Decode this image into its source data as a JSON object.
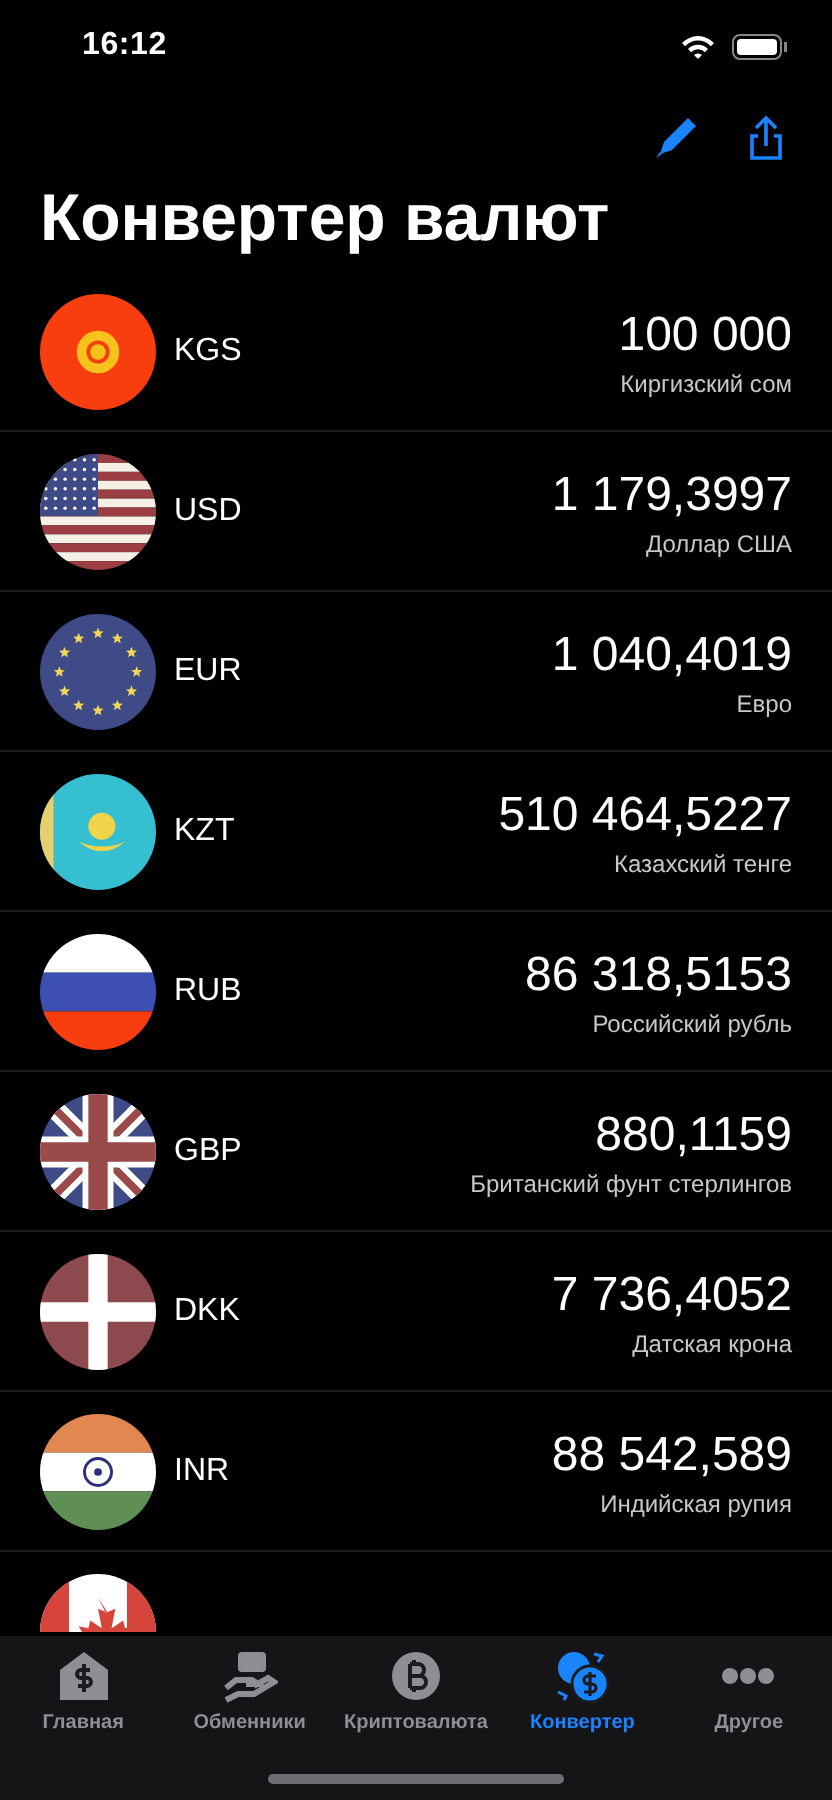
{
  "status_bar": {
    "time": "16:12"
  },
  "title": "Конвертер валют",
  "toolbar": [
    {
      "kind": "edit"
    },
    {
      "kind": "share"
    }
  ],
  "currencies": [
    {
      "code": "KGS",
      "amount": "100 000",
      "name": "Киргизский сом",
      "kind": "kyrgyzstan"
    },
    {
      "code": "USD",
      "amount": "1 179,3997",
      "name": "Доллар США",
      "kind": "usa"
    },
    {
      "code": "EUR",
      "amount": "1 040,4019",
      "name": "Евро",
      "kind": "eu"
    },
    {
      "code": "KZT",
      "amount": "510 464,5227",
      "name": "Казахский тенге",
      "kind": "kazakhstan"
    },
    {
      "code": "RUB",
      "amount": "86 318,5153",
      "name": "Российский рубль",
      "kind": "russia"
    },
    {
      "code": "GBP",
      "amount": "880,1159",
      "name": "Британский фунт стерлингов",
      "kind": "uk"
    },
    {
      "code": "DKK",
      "amount": "7 736,4052",
      "name": "Датская крона",
      "kind": "denmark"
    },
    {
      "code": "INR",
      "amount": "88 542,589",
      "name": "Индийская рупия",
      "kind": "india"
    },
    {
      "kind": "canada"
    }
  ],
  "tabs": [
    {
      "label": "Главная",
      "kind": "home",
      "selected": false
    },
    {
      "label": "Обменники",
      "kind": "exchangers",
      "selected": false
    },
    {
      "label": "Криптовалюта",
      "kind": "crypto",
      "selected": false
    },
    {
      "label": "Конвертер",
      "kind": "converter",
      "selected": true
    },
    {
      "label": "Другое",
      "kind": "more",
      "selected": false
    }
  ]
}
